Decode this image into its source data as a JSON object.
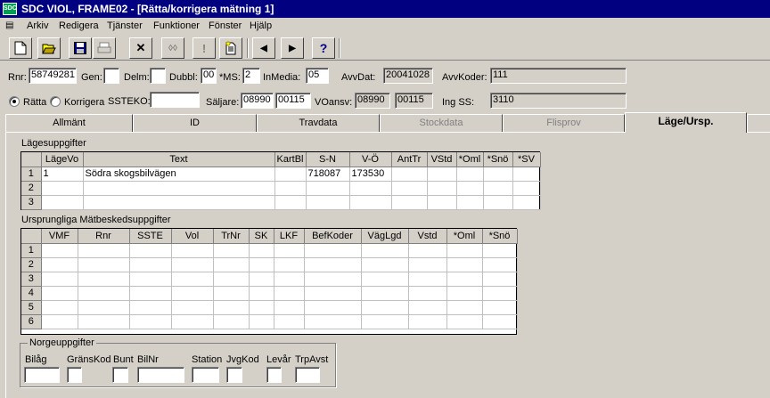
{
  "window": {
    "title": "SDC VIOL, FRAME02 - [Rätta/korrigera mätning 1]",
    "app_icon": "SDC"
  },
  "menu": [
    "Arkiv",
    "Redigera",
    "Tjänster",
    "Funktioner",
    "Fönster",
    "Hjälp"
  ],
  "toolbar": {
    "buttons": [
      "new-icon",
      "open-icon",
      "save-icon",
      "print-icon",
      "close-x-icon",
      "find-icon",
      "alert-icon",
      "document-icon",
      "prev-arrow-icon",
      "next-arrow-icon",
      "help-icon"
    ],
    "help_label": "?",
    "alert_label": "!",
    "find_label": "◊◊",
    "prev_label": "◀",
    "next_label": "▶",
    "close_label": "✕"
  },
  "header": {
    "rnr_label": "Rnr:",
    "rnr": "58749281",
    "gen_label": "Gen:",
    "gen": "",
    "delm_label": "Delm:",
    "delm": "",
    "dubbl_label": "Dubbl:",
    "dubbl": "00",
    "ms_label": "*MS:",
    "ms": "2",
    "inmedia_label": "InMedia:",
    "inmedia": "05",
    "avvdat_label": "AvvDat:",
    "avvdat": "20041028",
    "avvkoder_label": "AvvKoder:",
    "avvkoder": "111",
    "ratta_label": "Rätta",
    "korrigera_label": "Korrigera",
    "ssteko_label": "SSTEKO:",
    "ssteko": "",
    "saljare_label": "Säljare:",
    "saljare1": "08990",
    "saljare2": "00115",
    "voansv_label": "VOansv:",
    "voansv1": "08990",
    "voansv2": "00115",
    "ingss_label": "Ing SS:",
    "ingss": "3110"
  },
  "tabs": [
    {
      "label": "Allmänt",
      "state": "normal"
    },
    {
      "label": "ID",
      "state": "normal"
    },
    {
      "label": "Travdata",
      "state": "normal"
    },
    {
      "label": "Stockdata",
      "state": "disabled"
    },
    {
      "label": "Flisprov",
      "state": "disabled"
    },
    {
      "label": "Läge/Ursp.",
      "state": "active"
    }
  ],
  "lage": {
    "title": "Lägesuppgifter",
    "columns": [
      "",
      "LägeVo",
      "Text",
      "KartBl",
      "S-N",
      "V-Ö",
      "AntTr",
      "VStd",
      "*Oml",
      "*Snö",
      "*SV"
    ],
    "rows": [
      [
        "1",
        "1",
        "Södra skogsbilvägen",
        "",
        "718087",
        "173530",
        "",
        "",
        "",
        "",
        ""
      ],
      [
        "2",
        "",
        "",
        "",
        "",
        "",
        "",
        "",
        "",
        "",
        ""
      ],
      [
        "3",
        "",
        "",
        "",
        "",
        "",
        "",
        "",
        "",
        "",
        ""
      ]
    ]
  },
  "ursp": {
    "title": "Ursprungliga Mätbeskedsuppgifter",
    "columns": [
      "",
      "VMF",
      "Rnr",
      "SSTE",
      "Vol",
      "TrNr",
      "SK",
      "LKF",
      "BefKoder",
      "VägLgd",
      "Vstd",
      "*Oml",
      "*Snö"
    ],
    "rows": [
      [
        "1",
        "",
        "",
        "",
        "",
        "",
        "",
        "",
        "",
        "",
        "",
        "",
        ""
      ],
      [
        "2",
        "",
        "",
        "",
        "",
        "",
        "",
        "",
        "",
        "",
        "",
        "",
        ""
      ],
      [
        "3",
        "",
        "",
        "",
        "",
        "",
        "",
        "",
        "",
        "",
        "",
        "",
        ""
      ],
      [
        "4",
        "",
        "",
        "",
        "",
        "",
        "",
        "",
        "",
        "",
        "",
        "",
        ""
      ],
      [
        "5",
        "",
        "",
        "",
        "",
        "",
        "",
        "",
        "",
        "",
        "",
        "",
        ""
      ],
      [
        "6",
        "",
        "",
        "",
        "",
        "",
        "",
        "",
        "",
        "",
        "",
        "",
        ""
      ]
    ]
  },
  "norge": {
    "title": "Norgeuppgifter",
    "fields": [
      "Bilåg",
      "GränsKod",
      "Bunt",
      "BilNr",
      "Station",
      "JvgKod",
      "Levår",
      "TrpAvst"
    ]
  }
}
